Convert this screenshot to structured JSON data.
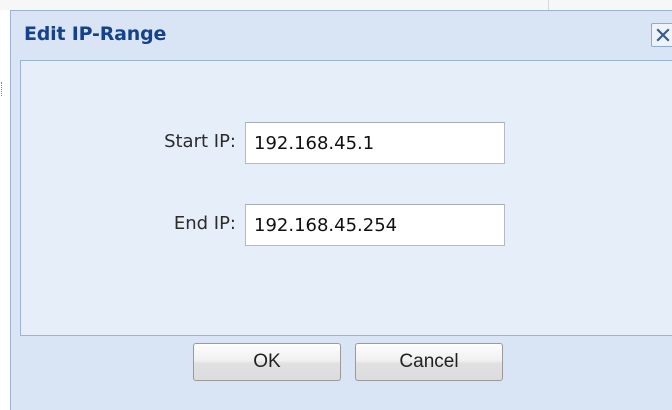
{
  "dialog": {
    "title": "Edit IP-Range",
    "close_icon": "close-icon",
    "colors": {
      "title": "#15428b",
      "frame": "#d9e5f4",
      "body": "#e6eefa",
      "border": "#99b4d4"
    }
  },
  "form": {
    "start_ip_label": "Start IP:",
    "start_ip_value": "192.168.45.1",
    "end_ip_label": "End IP:",
    "end_ip_value": "192.168.45.254"
  },
  "buttons": {
    "ok_label": "OK",
    "cancel_label": "Cancel"
  }
}
